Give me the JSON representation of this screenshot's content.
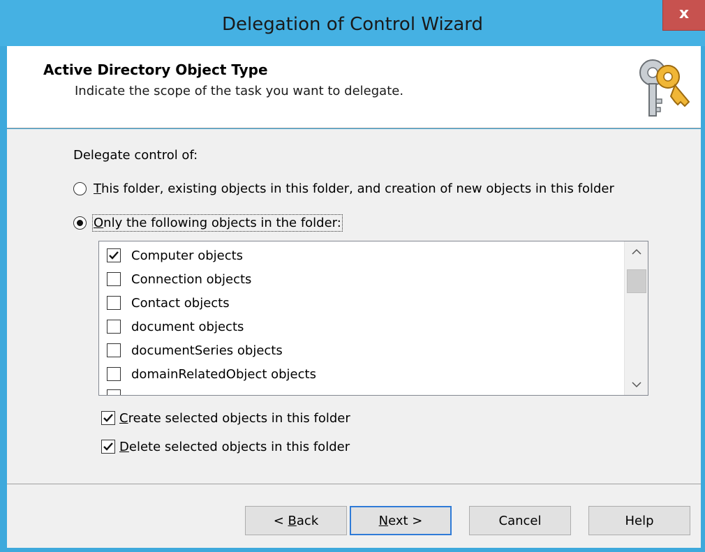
{
  "window": {
    "title": "Delegation of Control Wizard",
    "close_label": "x",
    "accent": "#45b1e3",
    "close_color": "#c7524f"
  },
  "header": {
    "title": "Active Directory Object Type",
    "subtitle": "Indicate the scope of the task you want to delegate.",
    "icon": "keys-icon"
  },
  "content": {
    "delegate_label": "Delegate control of:",
    "radio_all": {
      "mnemonic": "T",
      "rest": "his folder, existing objects in this folder, and creation of new objects in this folder",
      "selected": false
    },
    "radio_only": {
      "mnemonic": "O",
      "rest": "nly the following objects in the folder:",
      "selected": true
    },
    "objects": [
      {
        "label": "Computer objects",
        "checked": true
      },
      {
        "label": "Connection objects",
        "checked": false
      },
      {
        "label": "Contact objects",
        "checked": false
      },
      {
        "label": "document objects",
        "checked": false
      },
      {
        "label": "documentSeries objects",
        "checked": false
      },
      {
        "label": "domainRelatedObject objects",
        "checked": false
      }
    ],
    "create_option": {
      "mnemonic": "C",
      "rest": "reate selected objects in this folder",
      "checked": true
    },
    "delete_option": {
      "mnemonic": "D",
      "rest": "elete selected objects in this folder",
      "checked": true
    }
  },
  "footer": {
    "back_prefix": "< ",
    "back_mnemonic": "B",
    "back_rest": "ack",
    "next_mnemonic": "N",
    "next_rest": "ext >",
    "cancel": "Cancel",
    "help": "Help"
  }
}
